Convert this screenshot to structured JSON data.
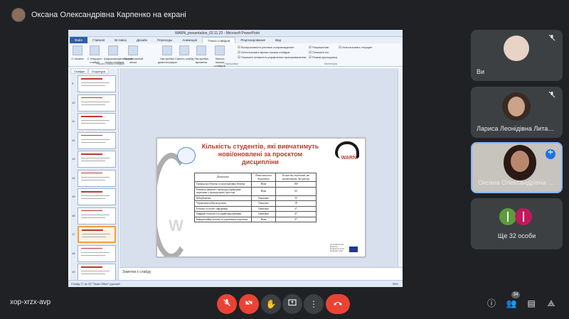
{
  "header": {
    "presenter_title": "Оксана Олександрівна Карпенко на екрані"
  },
  "powerpoint": {
    "window_title": "WARN_presentation_02.11.22  -  Microsoft PowerPoint",
    "tabs": [
      "Файл",
      "Главная",
      "Вставка",
      "Дизайн",
      "Переходы",
      "Анимация",
      "Показ слайдов",
      "Рецензирование",
      "Вид"
    ],
    "ribbon_buttons": [
      "С начала",
      "С текущего слайда",
      "Широковещательный показ слайдов",
      "Произвольный показ",
      "Настройка демонстрации",
      "Скрыть слайд",
      "Настройка времени",
      "Запись показа слайдов"
    ],
    "ribbon_checks": [
      "Воспроизвести речевое сопровождение",
      "Использовать время показа слайдов",
      "Показать элементы управления проигрывателем"
    ],
    "ribbon_right": [
      "Разрешение:",
      "Использовать текущее",
      "Показать на:",
      "Режим докладчика"
    ],
    "ribbon_groups": [
      "Начать показ слайдов",
      "Настройка",
      "Мониторы"
    ],
    "left_tabs": [
      "Слайды",
      "Структура"
    ],
    "thumb_numbers": [
      "9",
      "10",
      "11",
      "12",
      "13",
      "14",
      "15",
      "16",
      "17",
      "18",
      "19"
    ],
    "slide": {
      "title": "Кількість студентів, які вивчатимуть нові/оновлені за проєктом дисципліни",
      "brand": "WARN",
      "table_headers": [
        "Дисципліна",
        "Нова/оновлена дисципліна",
        "Кількість студентів, які вивчатимуть дисципліну"
      ],
      "table_rows": [
        [
          "Громадська безпека та кооперативна безпека",
          "Нова",
          "160"
        ],
        [
          "Розвиток навичок і процедур управління загрозами у громадському просторі",
          "Нова",
          "62"
        ],
        [
          "Кібербезпека",
          "Оновлена",
          "23"
        ],
        [
          "Управління кіберзагрозами",
          "Оновлена",
          "18"
        ],
        [
          "Безпека та захист інформації",
          "Оновлена",
          "47"
        ],
        [
          "Цифрові технології в управлінні кризами",
          "Оновлена",
          "47"
        ],
        [
          "Інформаційна безпека та управління загрозами",
          "Нова",
          "47"
        ]
      ],
      "eu_text": "Co-funded by the Erasmus+ Programme of the European Union"
    },
    "notes_placeholder": "Заметки к слайду",
    "status_left": "Слайд 17 из 23   \"Тема Office\"   русский",
    "status_right": "55%"
  },
  "participants": [
    {
      "name": "Ви",
      "mic": "mic-off"
    },
    {
      "name": "Лариса Леонідівна Лита…",
      "mic": "mic-off"
    },
    {
      "name": "Оксана Олександрівна К…",
      "mic": "speaking"
    },
    {
      "name": "Ще 32 особи"
    }
  ],
  "footer": {
    "meeting_code": "xop-xrzx-avp",
    "people_count": "34"
  },
  "colors": {
    "background": "#202124",
    "tile": "#3c4043",
    "danger": "#ea4335",
    "accent": "#1a73e8",
    "slide_title": "#c0392b"
  }
}
